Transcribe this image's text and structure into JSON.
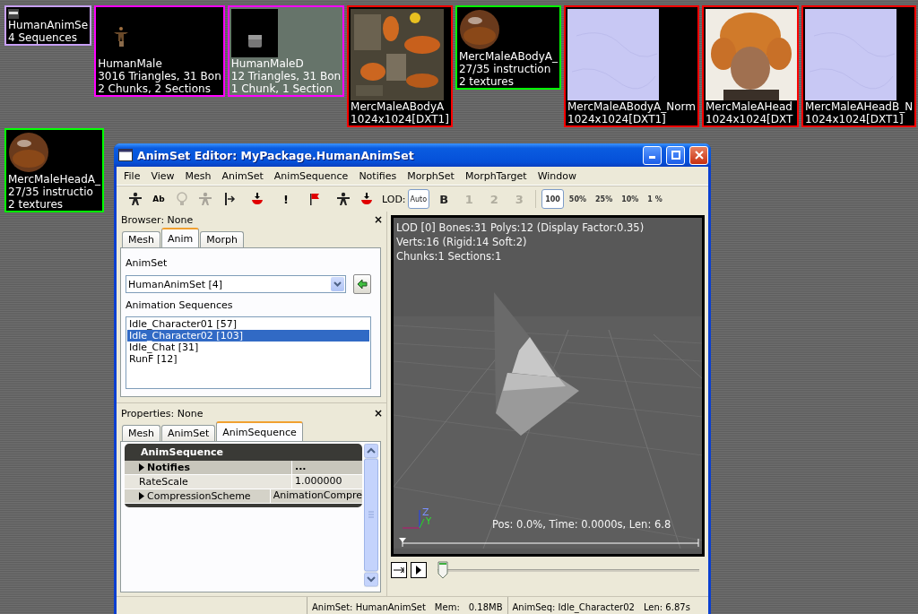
{
  "browser_rows": [
    [
      {
        "kind": "animset",
        "color": "#c8a0f8",
        "lines": [
          "HumanAnimSe",
          "4 Sequences"
        ]
      },
      {
        "kind": "mesh_figure",
        "color": "#ff00ff",
        "lines": [
          "HumanMale",
          "3016 Triangles, 31 Bon",
          "2 Chunks, 2 Sections"
        ]
      },
      {
        "kind": "mesh_block",
        "color": "#ff00ff",
        "lines": [
          "HumanMaleD",
          "12 Triangles, 31 Bon",
          "1 Chunk, 1 Section"
        ]
      },
      {
        "kind": "texture_body",
        "color": "#ff0000",
        "lines": [
          "MercMaleABodyA",
          "1024x1024[DXT1]"
        ]
      },
      {
        "kind": "material",
        "color": "#00ff00",
        "lines": [
          "MercMaleABodyA_",
          "27/35 instruction",
          "2 textures"
        ]
      },
      {
        "kind": "normal_map",
        "color": "#ff0000",
        "lines": [
          "MercMaleABodyA_Norm",
          "1024x1024[DXT1]"
        ]
      },
      {
        "kind": "texture_head",
        "color": "#ff0000",
        "lines": [
          "MercMaleAHead",
          "1024x1024[DXT"
        ]
      },
      {
        "kind": "normal_map",
        "color": "#ff0000",
        "lines": [
          "MercMaleAHeadB_N",
          "1024x1024[DXT1]"
        ]
      }
    ],
    [
      {
        "kind": "material",
        "color": "#00ff00",
        "lines": [
          "MercMaleHeadA_",
          "27/35 instructio",
          "2 textures"
        ]
      }
    ]
  ],
  "window": {
    "title": "AnimSet Editor: MyPackage.HumanAnimSet"
  },
  "menu": [
    "File",
    "View",
    "Mesh",
    "AnimSet",
    "AnimSequence",
    "Notifies",
    "MorphSet",
    "MorphTarget",
    "Window"
  ],
  "toolbar": {
    "text_buttons": [
      "Ab",
      "!"
    ],
    "lod_label": "LOD:",
    "lod_buttons": [
      {
        "label": "Auto",
        "selected": true,
        "disabled": false
      },
      {
        "label": "B",
        "selected": false,
        "disabled": false
      },
      {
        "label": "1",
        "selected": false,
        "disabled": true
      },
      {
        "label": "2",
        "selected": false,
        "disabled": true
      },
      {
        "label": "3",
        "selected": false,
        "disabled": true
      }
    ],
    "factor_buttons": [
      {
        "label": "100",
        "selected": true
      },
      {
        "label": "50%",
        "selected": false
      },
      {
        "label": "25%",
        "selected": false
      },
      {
        "label": "10%",
        "selected": false
      },
      {
        "label": "1 %",
        "selected": false
      }
    ]
  },
  "browser": {
    "title": "Browser: None",
    "close": "×",
    "tabs": [
      {
        "label": "Mesh",
        "selected": false
      },
      {
        "label": "Anim",
        "selected": true
      },
      {
        "label": "Morph",
        "selected": false
      }
    ],
    "animset_label": "AnimSet",
    "animset_value": "HumanAnimSet [4]",
    "sequences_label": "Animation Sequences",
    "sequences": [
      {
        "label": "Idle_Character01 [57]",
        "selected": false
      },
      {
        "label": "Idle_Character02 [103]",
        "selected": true
      },
      {
        "label": "Idle_Chat [31]",
        "selected": false
      },
      {
        "label": "RunF [12]",
        "selected": false
      }
    ]
  },
  "properties": {
    "title": "Properties: None",
    "close": "×",
    "tabs": [
      {
        "label": "Mesh",
        "selected": false
      },
      {
        "label": "AnimSet",
        "selected": false
      },
      {
        "label": "AnimSequence",
        "selected": true
      }
    ],
    "category": "AnimSequence",
    "rows": [
      {
        "kind": "struct",
        "name": "Notifies",
        "value": "...",
        "expanded": false
      },
      {
        "kind": "value",
        "name": "RateScale",
        "value": "1.000000"
      },
      {
        "kind": "object",
        "name": "CompressionScheme",
        "value": "AnimationCompre",
        "expanded": false
      }
    ]
  },
  "viewport": {
    "info": [
      "LOD [0] Bones:31 Polys:12 (Display Factor:0.35)",
      "Verts:16 (Rigid:14 Soft:2)",
      "Chunks:1 Sections:1"
    ],
    "axis_labels": [
      "Z",
      "Y"
    ],
    "footer": "Pos: 0.0%, Time: 0.0000s, Len: 6.8"
  },
  "playback": {
    "level": 0
  },
  "status_bar": [
    [
      "AnimSet: HumanAnimSet",
      "Mem:",
      "0.18MB"
    ],
    [
      "AnimSeq: Idle_Character02",
      "Len: 6.87s"
    ]
  ]
}
